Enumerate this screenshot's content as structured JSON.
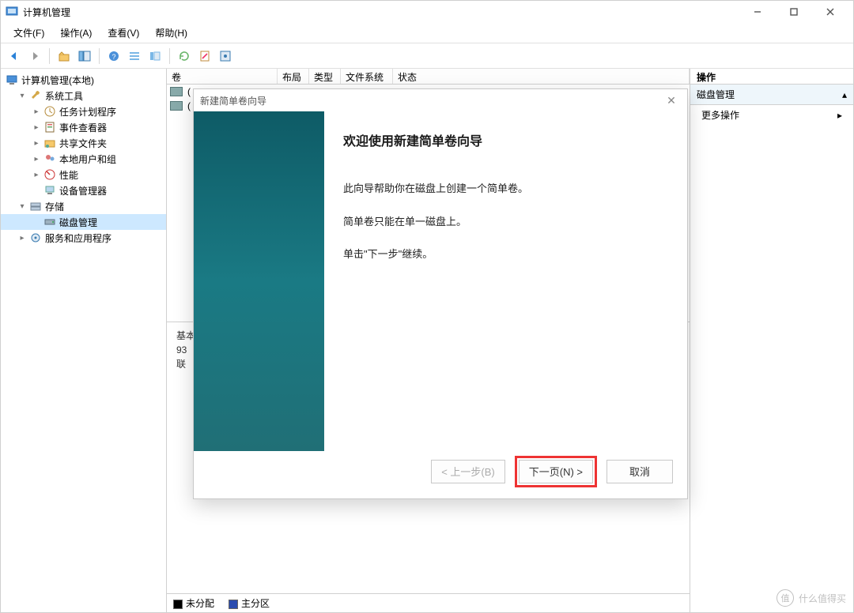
{
  "titlebar": {
    "title": "计算机管理"
  },
  "menubar": {
    "file": "文件(F)",
    "action": "操作(A)",
    "view": "查看(V)",
    "help": "帮助(H)"
  },
  "navtree": {
    "root": "计算机管理(本地)",
    "system_tools": "系统工具",
    "task_scheduler": "任务计划程序",
    "event_viewer": "事件查看器",
    "shared_folders": "共享文件夹",
    "local_users": "本地用户和组",
    "performance": "性能",
    "device_manager": "设备管理器",
    "storage": "存储",
    "disk_management": "磁盘管理",
    "services": "服务和应用程序"
  },
  "list_headers": {
    "volume": "卷",
    "layout": "布局",
    "type": "类型",
    "filesystem": "文件系统",
    "status": "状态"
  },
  "list_rows": {
    "r0": "(",
    "r1": "("
  },
  "diskpane": {
    "line1": "基本",
    "line2": "93",
    "line3": "联"
  },
  "legend": {
    "unallocated": "未分配",
    "primary": "主分区"
  },
  "actions": {
    "header": "操作",
    "sub": "磁盘管理",
    "more": "更多操作"
  },
  "wizard": {
    "dlg_title": "新建简单卷向导",
    "heading": "欢迎使用新建简单卷向导",
    "p1": "此向导帮助你在磁盘上创建一个简单卷。",
    "p2": "简单卷只能在单一磁盘上。",
    "p3": "单击\"下一步\"继续。",
    "btn_back": "< 上一步(B)",
    "btn_next": "下一页(N) >",
    "btn_cancel": "取消"
  },
  "watermark": {
    "badge": "值",
    "text": "什么值得买"
  }
}
